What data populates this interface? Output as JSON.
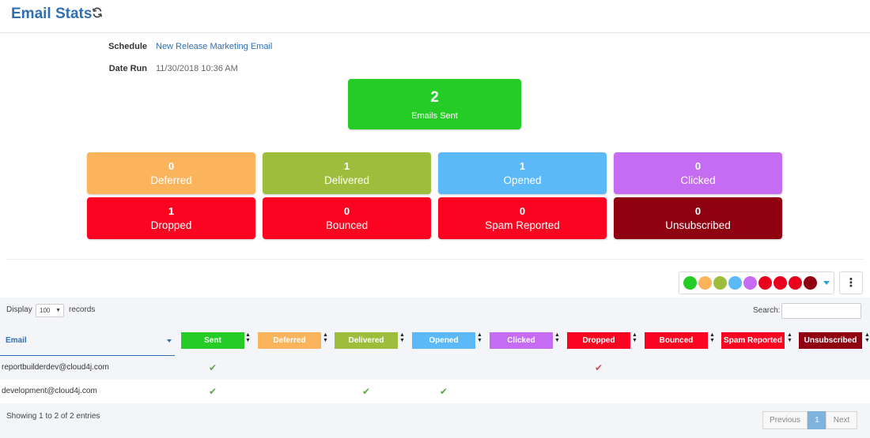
{
  "header": {
    "title": "Email Stats",
    "refresh_icon": "refresh-icon"
  },
  "meta": {
    "schedule_label": "Schedule",
    "schedule_value": "New Release Marketing Email",
    "date_label": "Date Run",
    "date_value": "11/30/2018 10:36 AM"
  },
  "summary": {
    "value": "2",
    "label": "Emails Sent",
    "color": "#26cc26"
  },
  "stats": [
    {
      "value": "0",
      "label": "Deferred",
      "color": "#fbb35c"
    },
    {
      "value": "1",
      "label": "Delivered",
      "color": "#9dbe3d"
    },
    {
      "value": "1",
      "label": "Opened",
      "color": "#5bb9f8"
    },
    {
      "value": "0",
      "label": "Clicked",
      "color": "#c66cf2"
    },
    {
      "value": "1",
      "label": "Dropped",
      "color": "#fb0422"
    },
    {
      "value": "0",
      "label": "Bounced",
      "color": "#fb0422"
    },
    {
      "value": "0",
      "label": "Spam Reported",
      "color": "#fb0422"
    },
    {
      "value": "0",
      "label": "Unsubscribed",
      "color": "#8f0011"
    }
  ],
  "palette": [
    "#26cc26",
    "#fbb35c",
    "#9dbe3d",
    "#5bb9f8",
    "#c66cf2",
    "#e8001d",
    "#e8001d",
    "#e8001d",
    "#8f0011"
  ],
  "table_controls": {
    "display_label": "Display",
    "page_length": "100",
    "records_label": "records",
    "search_label": "Search:"
  },
  "table": {
    "email_header": "Email",
    "columns": [
      {
        "label": "Sent",
        "color": "#26cc26"
      },
      {
        "label": "Deferred",
        "color": "#fbb35c"
      },
      {
        "label": "Delivered",
        "color": "#9dbe3d"
      },
      {
        "label": "Opened",
        "color": "#5bb9f8"
      },
      {
        "label": "Clicked",
        "color": "#c66cf2"
      },
      {
        "label": "Dropped",
        "color": "#fb0422"
      },
      {
        "label": "Bounced",
        "color": "#fb0422"
      },
      {
        "label": "Spam Reported",
        "color": "#fb0422"
      },
      {
        "label": "Unsubscribed",
        "color": "#8f0011"
      }
    ],
    "rows": [
      {
        "email": "reportbuilderdev@cloud4j.com",
        "checks": [
          "Sent",
          "Dropped"
        ]
      },
      {
        "email": "development@cloud4j.com",
        "checks": [
          "Sent",
          "Delivered",
          "Opened"
        ]
      }
    ],
    "check_color": "#5fa34a",
    "check_color_alert": "#c9504a"
  },
  "footer": {
    "info": "Showing 1 to 2 of 2 entries",
    "previous": "Previous",
    "page": "1",
    "next": "Next"
  }
}
